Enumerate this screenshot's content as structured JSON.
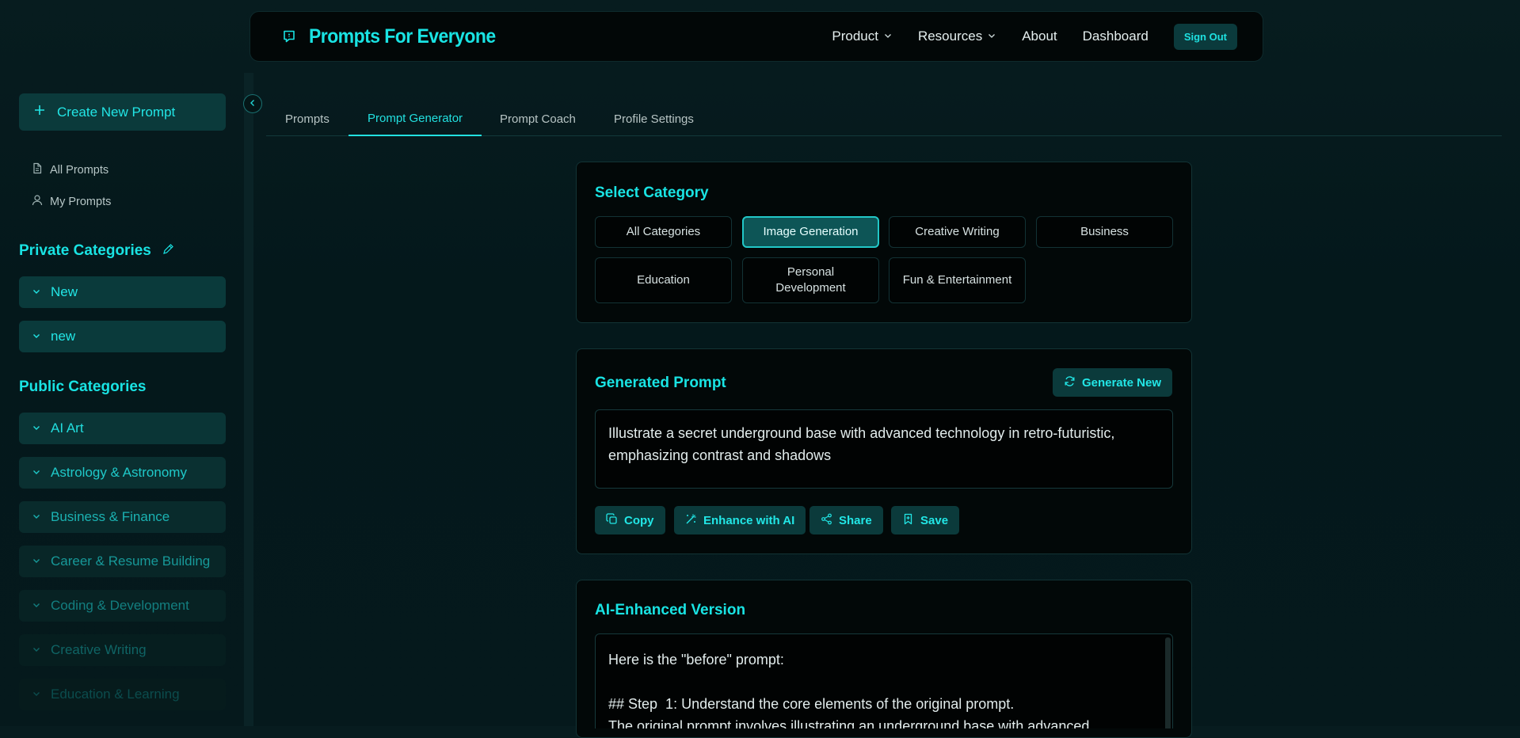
{
  "nav": {
    "brand": "Prompts For Everyone",
    "links": {
      "product": "Product",
      "resources": "Resources",
      "about": "About",
      "dashboard": "Dashboard"
    },
    "sign_out": "Sign Out"
  },
  "sidebar": {
    "create_button": "Create New Prompt",
    "links": {
      "all_prompts": "All Prompts",
      "my_prompts": "My Prompts"
    },
    "private_title": "Private Categories",
    "private_items": [
      "New",
      "new"
    ],
    "public_title": "Public Categories",
    "public_items": [
      "AI Art",
      "Astrology & Astronomy",
      "Business & Finance",
      "Career & Resume Building",
      "Coding & Development",
      "Creative Writing",
      "Education & Learning"
    ]
  },
  "tabs": [
    "Prompts",
    "Prompt Generator",
    "Prompt Coach",
    "Profile Settings"
  ],
  "active_tab": "Prompt Generator",
  "select_category": {
    "title": "Select Category",
    "categories": [
      "All Categories",
      "Image Generation",
      "Creative Writing",
      "Business",
      "Education",
      "Personal Development",
      "Fun & Entertainment"
    ],
    "selected": "Image Generation"
  },
  "generated": {
    "title": "Generated Prompt",
    "generate_new": "Generate New",
    "prompt_line1": "Illustrate a secret underground base with advanced technology in retro-futuristic,",
    "prompt_line2": "emphasizing contrast and shadows",
    "actions": {
      "copy": "Copy",
      "enhance": "Enhance with AI",
      "share": "Share",
      "save": "Save"
    }
  },
  "enhanced": {
    "title": "AI-Enhanced Version",
    "line1": "Here is the \"before\" prompt:",
    "line2": "## Step  1: Understand the core elements of the original prompt.",
    "line3": "The original prompt involves illustrating an underground base with advanced"
  },
  "colors": {
    "accent": "#19e3e3",
    "button_bg": "#0b3a3b",
    "background": "#071c1f"
  }
}
